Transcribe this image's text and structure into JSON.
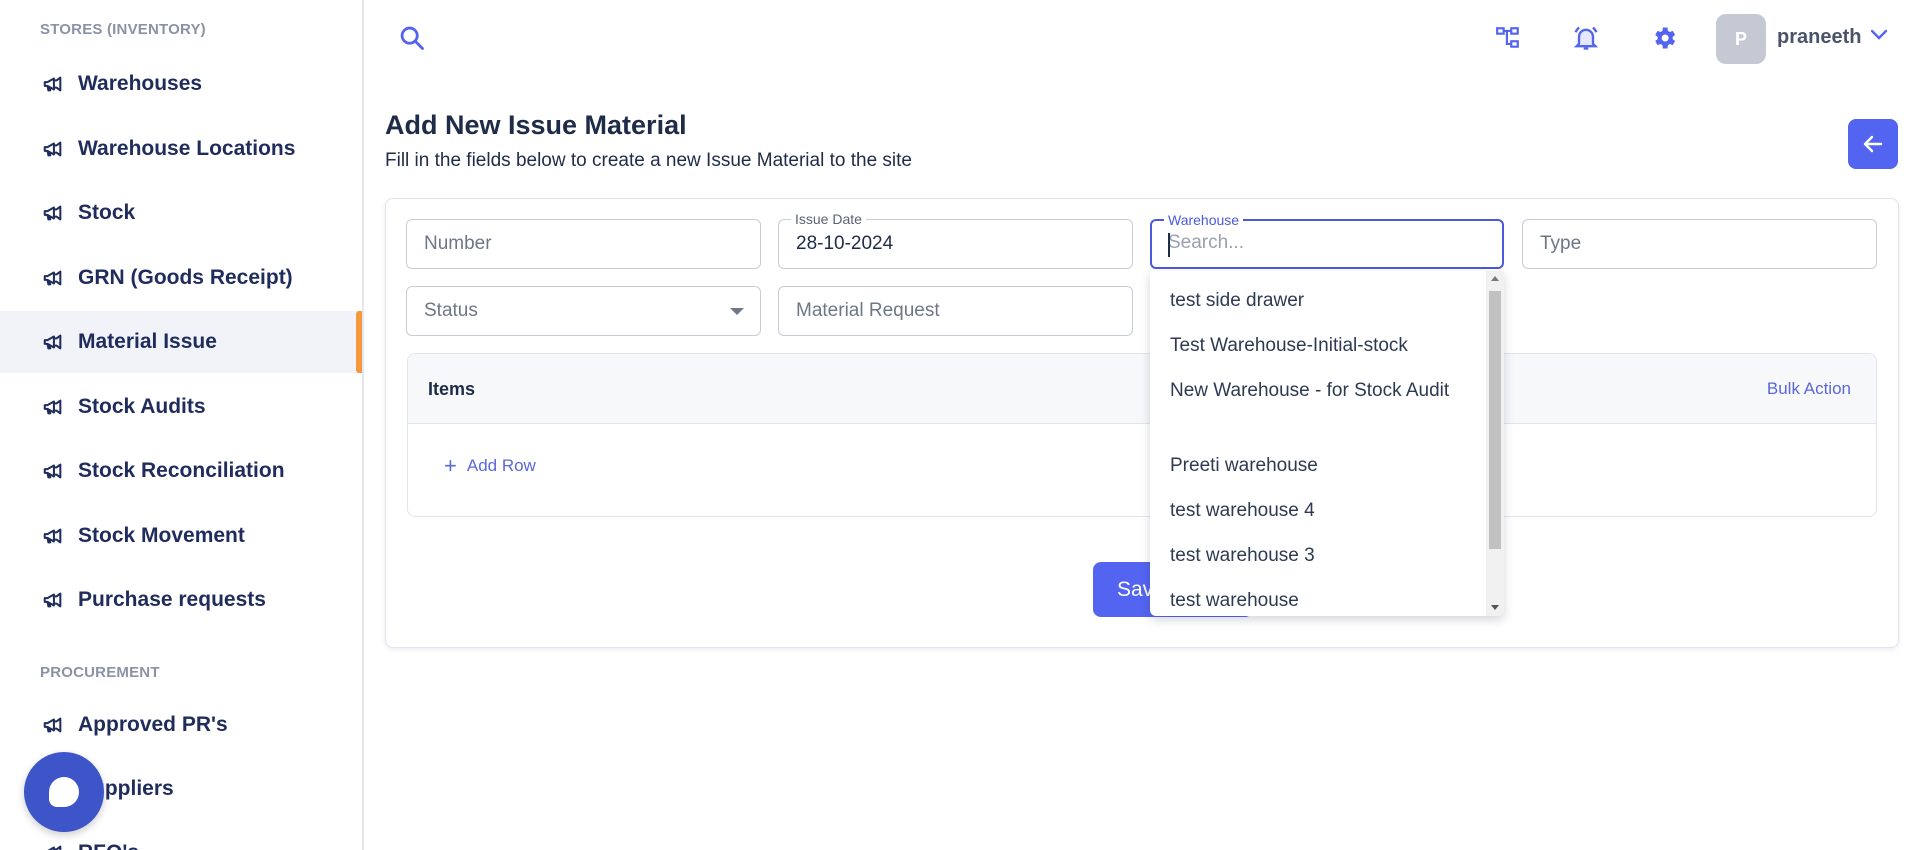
{
  "sidebar": {
    "section_inventory": "STORES (INVENTORY)",
    "section_procurement": "PROCUREMENT",
    "items": [
      {
        "label": "Warehouses"
      },
      {
        "label": "Warehouse Locations"
      },
      {
        "label": "Stock"
      },
      {
        "label": "GRN (Goods Receipt)"
      },
      {
        "label": "Material Issue",
        "active": true
      },
      {
        "label": "Stock Audits"
      },
      {
        "label": "Stock Reconciliation"
      },
      {
        "label": "Stock Movement"
      },
      {
        "label": "Purchase requests"
      },
      {
        "label": "Approved PR's"
      },
      {
        "label": "Suppliers"
      },
      {
        "label": "RFQ's"
      }
    ]
  },
  "topbar": {
    "avatar_initial": "P",
    "username": "praneeth",
    "icons": [
      "search-icon",
      "hierarchy-icon",
      "bell-icon",
      "gear-icon",
      "chevron-down-icon"
    ]
  },
  "header": {
    "title": "Add New Issue Material",
    "subtitle": "Fill in the fields below to create a new Issue Material to the site"
  },
  "form": {
    "number_placeholder": "Number",
    "issue_date_label": "Issue Date",
    "issue_date_value": "28-10-2024",
    "warehouse_label": "Warehouse",
    "warehouse_placeholder": "Search...",
    "type_placeholder": "Type",
    "status_placeholder": "Status",
    "material_request_placeholder": "Material Request"
  },
  "items": {
    "title": "Items",
    "bulk_action": "Bulk Action",
    "add_row": "Add Row"
  },
  "save_label": "Save",
  "warehouse_options": [
    "test side drawer",
    "Test Warehouse-Initial-stock",
    "New Warehouse - for Stock Audit",
    "Preeti warehouse",
    "test warehouse 4",
    "test warehouse 3",
    "test warehouse"
  ],
  "colors": {
    "accent": "#5365f0",
    "active_indicator": "#f59a3c",
    "nav_text": "#1f2c5c"
  }
}
